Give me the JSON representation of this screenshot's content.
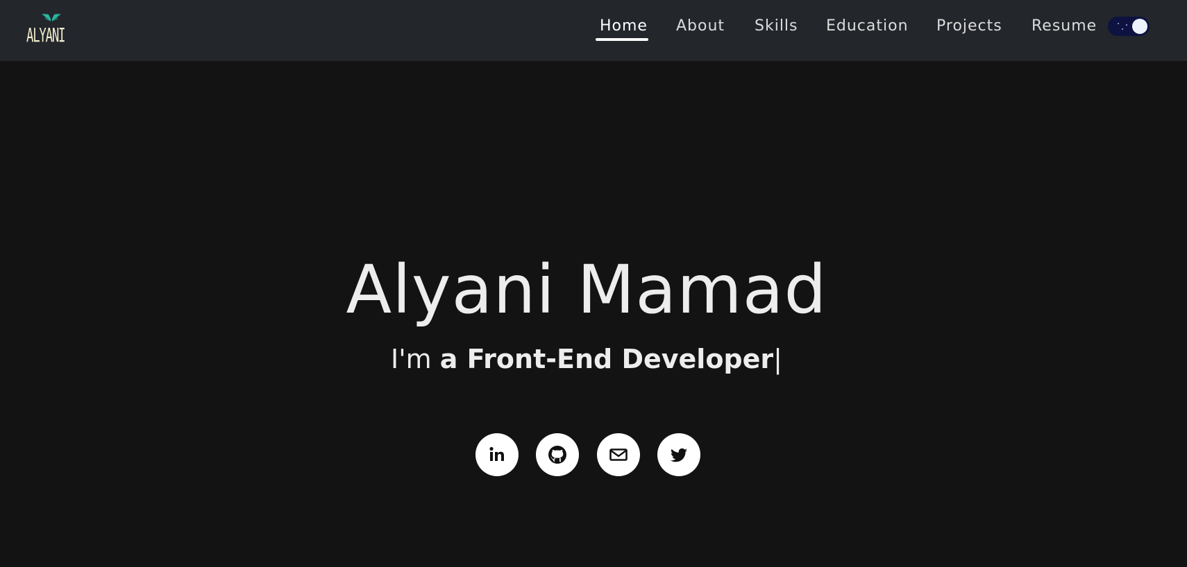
{
  "brand": {
    "logo_text": "ALYANI",
    "logo_icon": "wings-icon",
    "accent_color": "#2bb5a0"
  },
  "nav": {
    "items": [
      {
        "label": "Home",
        "active": true
      },
      {
        "label": "About",
        "active": false
      },
      {
        "label": "Skills",
        "active": false
      },
      {
        "label": "Education",
        "active": false
      },
      {
        "label": "Projects",
        "active": false
      },
      {
        "label": "Resume",
        "active": false
      }
    ],
    "theme_toggle": {
      "state": "dark",
      "icon": "moon-icon",
      "track_color": "#0d1240"
    }
  },
  "hero": {
    "name": "Alyani Mamad",
    "intro_prefix": "I'm ",
    "intro_emphasis": "a Front-End Developer",
    "cursor": "|"
  },
  "socials": [
    {
      "icon": "linkedin-icon"
    },
    {
      "icon": "github-icon"
    },
    {
      "icon": "mail-icon"
    },
    {
      "icon": "twitter-icon"
    }
  ],
  "colors": {
    "background": "#131313",
    "navbar": "#23262b",
    "text": "#ededed"
  }
}
